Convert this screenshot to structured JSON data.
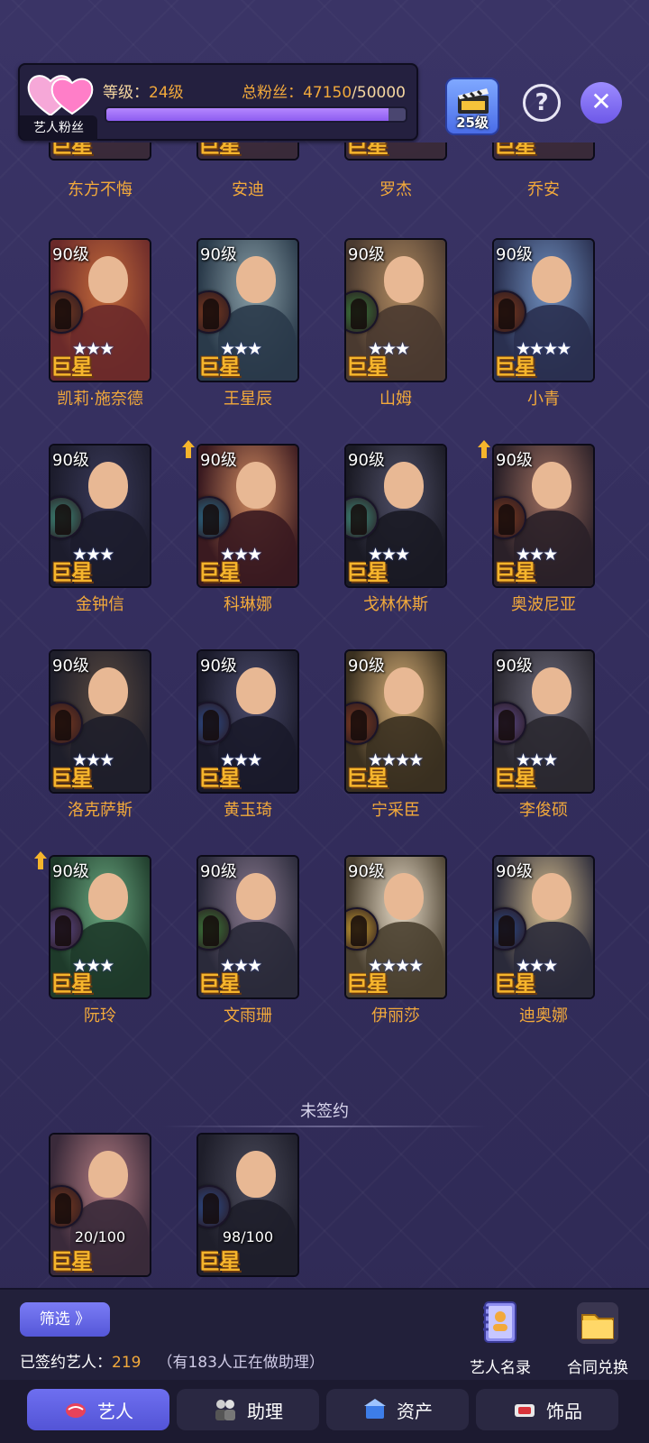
{
  "header": {
    "fans_tag": "艺人粉丝",
    "level_label": "等级：",
    "level_value": "24级",
    "fans_label": "总粉丝：",
    "fans_current": "47150",
    "fans_separator": "/",
    "fans_max": "50000",
    "fans_progress": 0.943,
    "clapper_level": "25级",
    "help_symbol": "?",
    "close_symbol": "✕"
  },
  "top_partial_names": [
    "东方不悔",
    "安迪",
    "罗杰",
    "乔安"
  ],
  "partial_rank": "巨星",
  "signed_artists": [
    {
      "name": "凯莉·施奈德",
      "level": "90级",
      "rank": "巨星",
      "stars": "★★★",
      "up": false
    },
    {
      "name": "王星辰",
      "level": "90级",
      "rank": "巨星",
      "stars": "★★★",
      "up": false
    },
    {
      "name": "山姆",
      "level": "90级",
      "rank": "巨星",
      "stars": "★★★",
      "up": false
    },
    {
      "name": "小青",
      "level": "90级",
      "rank": "巨星",
      "stars": "★★★★",
      "up": false
    },
    {
      "name": "金钟信",
      "level": "90级",
      "rank": "巨星",
      "stars": "★★★",
      "up": false
    },
    {
      "name": "科琳娜",
      "level": "90级",
      "rank": "巨星",
      "stars": "★★★",
      "up": true
    },
    {
      "name": "戈林休斯",
      "level": "90级",
      "rank": "巨星",
      "stars": "★★★",
      "up": false
    },
    {
      "name": "奥波尼亚",
      "level": "90级",
      "rank": "巨星",
      "stars": "★★★",
      "up": true
    },
    {
      "name": "洛克萨斯",
      "level": "90级",
      "rank": "巨星",
      "stars": "★★★",
      "up": false
    },
    {
      "name": "黄玉琦",
      "level": "90级",
      "rank": "巨星",
      "stars": "★★★",
      "up": false
    },
    {
      "name": "宁采臣",
      "level": "90级",
      "rank": "巨星",
      "stars": "★★★★",
      "up": false
    },
    {
      "name": "李俊硕",
      "level": "90级",
      "rank": "巨星",
      "stars": "★★★",
      "up": false
    },
    {
      "name": "阮玲",
      "level": "90级",
      "rank": "巨星",
      "stars": "★★★",
      "up": true
    },
    {
      "name": "文雨珊",
      "level": "90级",
      "rank": "巨星",
      "stars": "★★★",
      "up": false
    },
    {
      "name": "伊丽莎",
      "level": "90级",
      "rank": "巨星",
      "stars": "★★★★",
      "up": false
    },
    {
      "name": "迪奥娜",
      "level": "90级",
      "rank": "巨星",
      "stars": "★★★",
      "up": false
    }
  ],
  "unsigned_section": {
    "title": "未签约",
    "artists": [
      {
        "progress_text": "20/100",
        "rank": "巨星"
      },
      {
        "progress_text": "98/100",
        "rank": "巨星"
      }
    ]
  },
  "bottom": {
    "filter_label": "筛选 》",
    "signed_label": "已签约艺人：",
    "signed_count": "219",
    "assistant_note": "（有183人正在做助理）",
    "roster_label": "艺人名录",
    "contract_label": "合同兑换"
  },
  "tabs": [
    {
      "label": "艺人",
      "active": true
    },
    {
      "label": "助理",
      "active": false
    },
    {
      "label": "资产",
      "active": false
    },
    {
      "label": "饰品",
      "active": false
    }
  ],
  "colors": {
    "accent_gold": "#f2a93b",
    "rank_gold": "#f6b52c",
    "progress_purple": "#9b6cf7",
    "tab_active": "#6364e4"
  }
}
